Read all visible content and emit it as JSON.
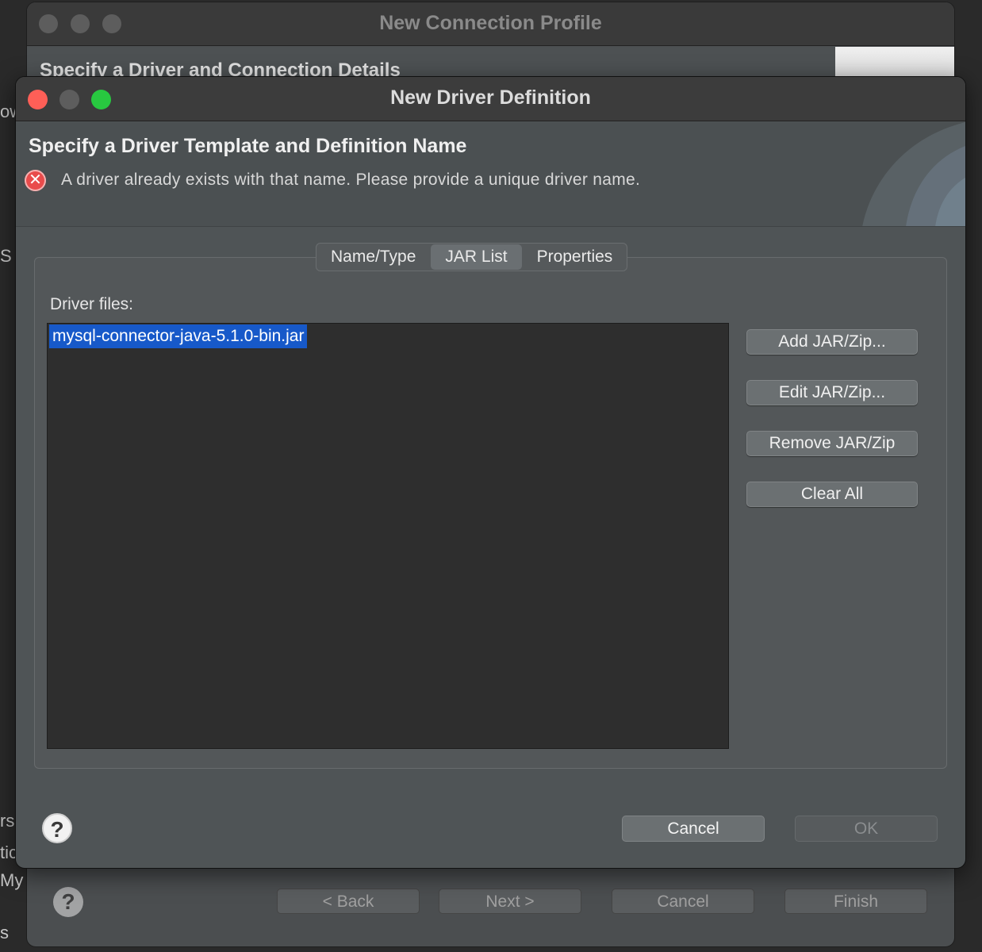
{
  "background_window": {
    "title": "New Connection Profile",
    "header_title": "Specify a Driver and Connection Details",
    "buttons": {
      "back": "< Back",
      "next": "Next >",
      "cancel": "Cancel",
      "finish": "Finish"
    },
    "help_label": "?",
    "edge_fragments": [
      "ow",
      "S",
      "rs",
      "tic",
      "My",
      "s"
    ]
  },
  "dialog": {
    "title": "New Driver Definition",
    "header": {
      "title": "Specify a Driver Template and Definition Name",
      "error_message": "A driver already exists with that name. Please provide a unique driver name."
    },
    "tabs": [
      {
        "label": "Name/Type",
        "active": false
      },
      {
        "label": "JAR List",
        "active": true
      },
      {
        "label": "Properties",
        "active": false
      }
    ],
    "driver_files_label": "Driver files:",
    "driver_files": [
      "mysql-connector-java-5.1.0-bin.jar"
    ],
    "side_buttons": {
      "add": "Add JAR/Zip...",
      "edit": "Edit JAR/Zip...",
      "remove": "Remove JAR/Zip",
      "clear": "Clear All"
    },
    "footer": {
      "cancel": "Cancel",
      "ok": "OK",
      "help": "?"
    }
  },
  "colors": {
    "selection": "#1759c9",
    "close": "#fe5f57",
    "maximize": "#28c840",
    "error": "#e94b4b"
  }
}
